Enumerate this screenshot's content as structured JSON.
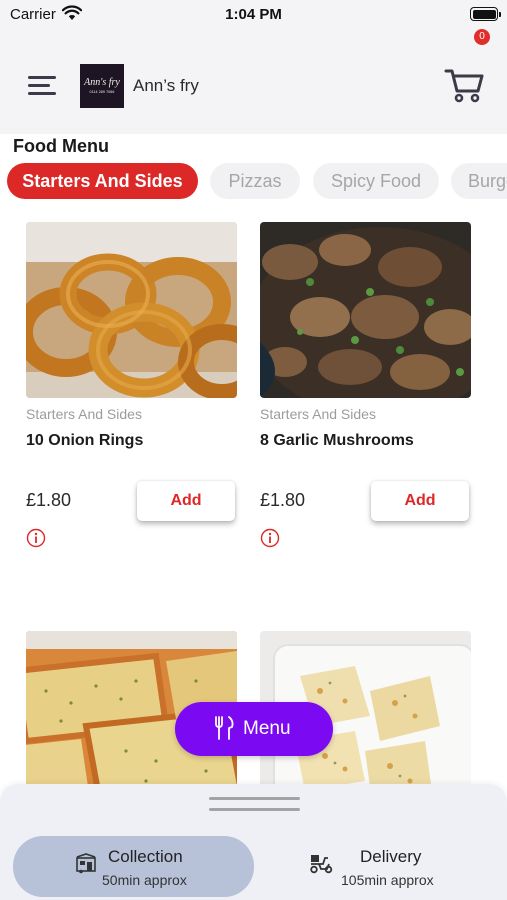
{
  "status_bar": {
    "carrier": "Carrier",
    "time": "1:04 PM",
    "icons": [
      "wifi-icon",
      "battery-icon"
    ]
  },
  "header": {
    "menu_icon": "hamburger-icon",
    "logo": {
      "text": "Ann's fry",
      "subtext": "0114 289 7066"
    },
    "shop_name": "Ann’s fry",
    "cart": {
      "icon": "cart-icon",
      "count": "0"
    }
  },
  "page_title": "Food Menu",
  "categories": [
    {
      "label": "Starters And Sides",
      "active": true
    },
    {
      "label": "Pizzas",
      "active": false
    },
    {
      "label": "Spicy Food",
      "active": false
    },
    {
      "label": "Burgers",
      "active": false
    }
  ],
  "products": [
    {
      "category": "Starters And Sides",
      "name": "10 Onion Rings",
      "price": "£1.80",
      "add_label": "Add",
      "info_icon": "info-icon"
    },
    {
      "category": "Starters And Sides",
      "name": "8 Garlic Mushrooms",
      "price": "£1.80",
      "add_label": "Add",
      "info_icon": "info-icon"
    },
    {
      "category": "",
      "name": "",
      "price": "",
      "add_label": "",
      "info_icon": ""
    },
    {
      "category": "",
      "name": "",
      "price": "",
      "add_label": "",
      "info_icon": ""
    }
  ],
  "menu_button": {
    "label": "Menu",
    "icon": "fork-spoon-icon"
  },
  "order_options": [
    {
      "title": "Collection",
      "subtitle": "50min approx",
      "icon": "takeaway-shop-icon",
      "selected": true
    },
    {
      "title": "Delivery",
      "subtitle": "105min approx",
      "icon": "delivery-scooter-icon",
      "selected": false
    }
  ],
  "colors": {
    "accent_red": "#dd2828",
    "menu_purple": "#7b09f2",
    "selected_option": "#b7c2d9",
    "header_bg": "#f4f4f6"
  }
}
